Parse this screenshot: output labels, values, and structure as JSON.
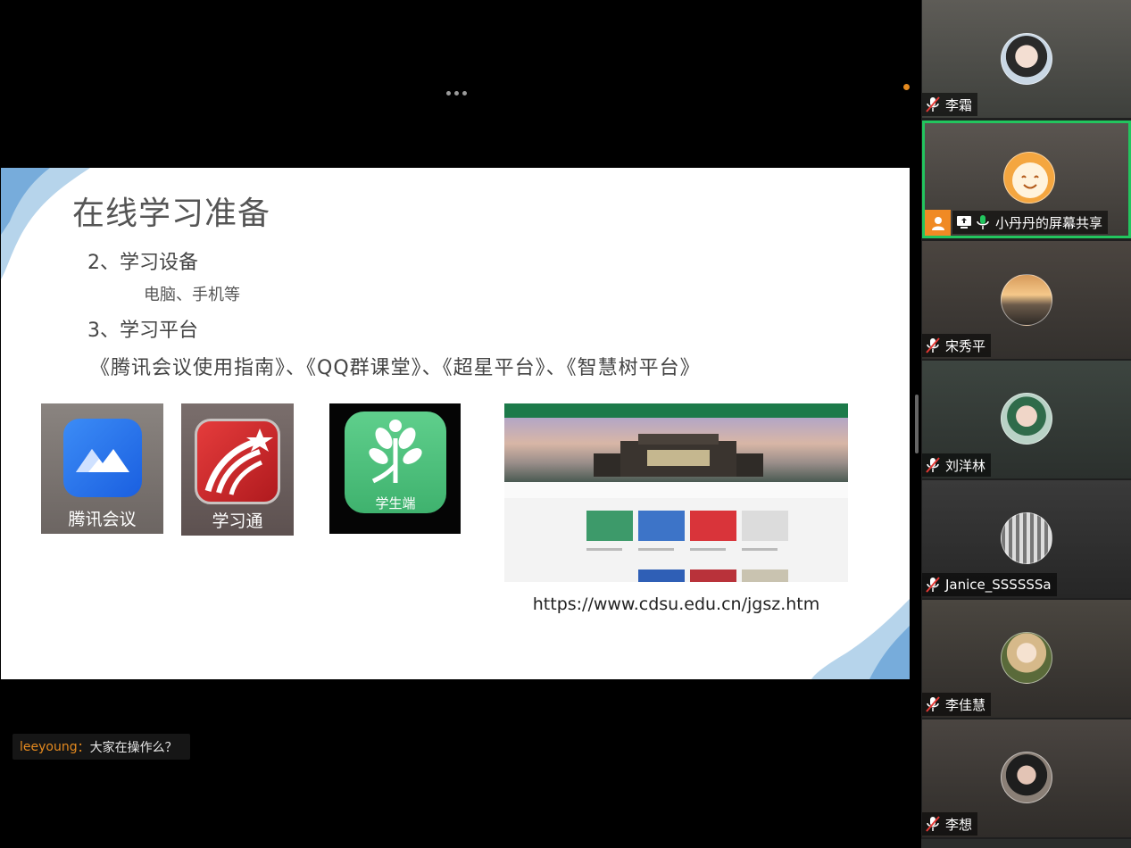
{
  "slide": {
    "title": "在线学习准备",
    "item2": "2、学习设备",
    "item2_sub": "电脑、手机等",
    "item3": "3、学习平台",
    "platforms": "《腾讯会议使用指南》、《QQ群课堂》、《超星平台》、《智慧树平台》",
    "apps": {
      "meeting_label": "腾讯会议",
      "xuexitong_label": "学习通",
      "zhihuishu_label": "学生端"
    },
    "website_url": "https://www.cdsu.edu.cn/jgsz.htm"
  },
  "chat": {
    "sender": "leeyoung",
    "separator": "：",
    "text": "大家在操作么？"
  },
  "participants": [
    {
      "name": "李霜",
      "muted": true
    },
    {
      "name": "小丹丹的屏幕共享",
      "muted": false,
      "sharing": true
    },
    {
      "name": "宋秀平",
      "muted": true
    },
    {
      "name": "刘洋林",
      "muted": true
    },
    {
      "name": "Janice_SSSSSSa",
      "muted": true
    },
    {
      "name": "李佳慧",
      "muted": true
    },
    {
      "name": "李想",
      "muted": true
    }
  ],
  "colors": {
    "active_border": "#22c55e",
    "accent_orange": "#f08a24",
    "site_nav_green": "#1c7a4a"
  }
}
